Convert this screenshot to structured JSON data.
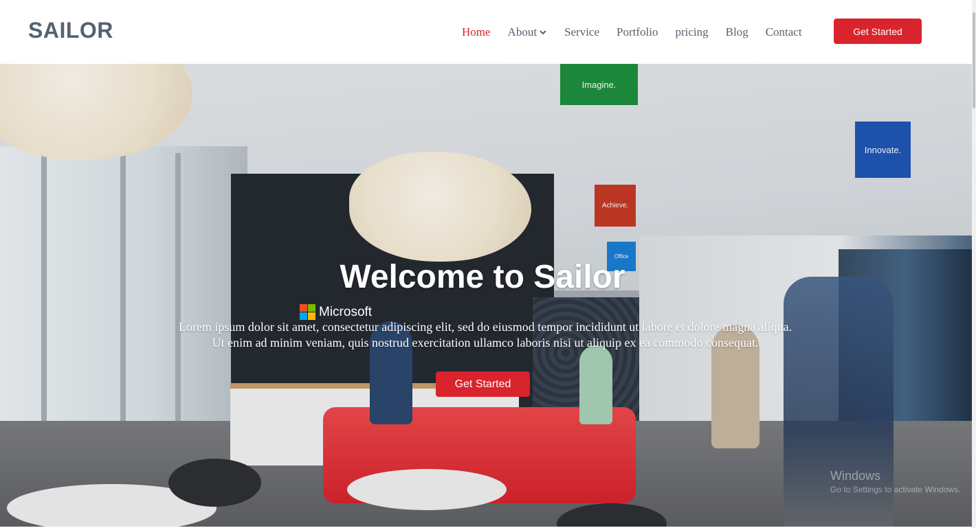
{
  "header": {
    "logo": "SAILOR",
    "nav": [
      {
        "label": "Home",
        "active": true
      },
      {
        "label": "About",
        "dropdown": true
      },
      {
        "label": "Service"
      },
      {
        "label": "Portfolio"
      },
      {
        "label": "pricing"
      },
      {
        "label": "Blog"
      },
      {
        "label": "Contact"
      }
    ],
    "cta_label": "Get Started"
  },
  "hero": {
    "title": "Welcome to Sailor",
    "description_line1": "Lorem ipsum dolor sit amet, consectetur adipiscing elit, sed do eiusmod tempor incididunt ut labore et dolore magna aliqua.",
    "description_line2": "Ut enim ad minim veniam, quis nostrud exercitation ullamco laboris nisi ut aliquip ex ea commodo consequat.",
    "button_label": "Get Started",
    "photo_texts": {
      "microsoft": "Microsoft",
      "banner_imagine": "Imagine.",
      "banner_innovate": "Innovate.",
      "banner_achieve": "Achieve.",
      "banner_office": "Office"
    },
    "watermark": {
      "title": "Windows",
      "subtitle": "Go to Settings to activate Windows."
    }
  },
  "colors": {
    "accent": "#d9232d",
    "nav_text": "#556270",
    "logo": "#556270"
  },
  "icons": {
    "about_dropdown": "chevron-down-icon"
  }
}
